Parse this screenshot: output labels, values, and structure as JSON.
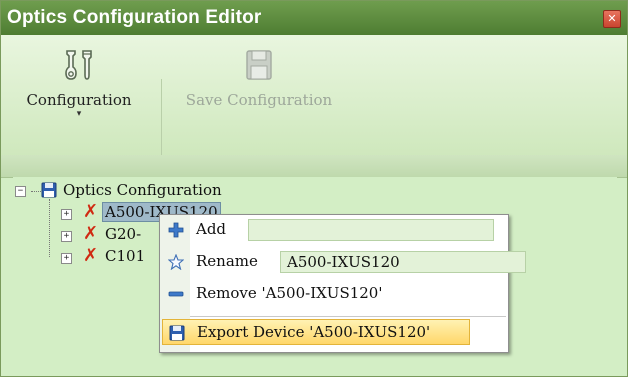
{
  "window": {
    "title": "Optics Configuration Editor",
    "close_symbol": "✕"
  },
  "toolbar": {
    "configuration_label": "Configuration",
    "configuration_icon": "tools-icon",
    "save_label": "Save Configuration",
    "save_icon": "save-icon",
    "save_enabled": false
  },
  "tree": {
    "root": {
      "label": "Optics Configuration",
      "expanded": true
    },
    "nodes": [
      {
        "label": "A500-IXUS120",
        "selected": true
      },
      {
        "label": "G20-"
      },
      {
        "label": "C101"
      }
    ],
    "status_icon": "red-x-icon"
  },
  "context_menu": {
    "add_label": "Add",
    "add_value": "",
    "rename_label": "Rename",
    "rename_value": "A500-IXUS120",
    "remove_label": "Remove 'A500-IXUS120'",
    "export_label": "Export Device 'A500-IXUS120'"
  },
  "colors": {
    "titlebar": "#5a8a3c",
    "background": "#d3eec5",
    "highlight": "#ffd76a"
  }
}
